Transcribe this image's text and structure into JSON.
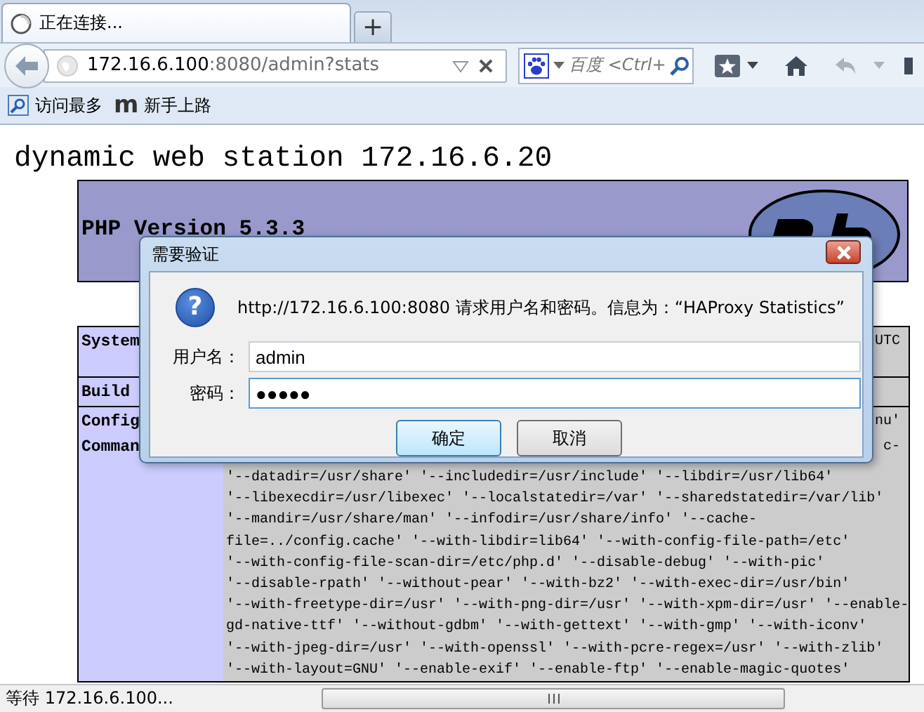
{
  "browser": {
    "tab": {
      "title": "正在连接...",
      "loading": true
    },
    "new_tab": "+",
    "address": {
      "host": "172.16.6.100",
      "rest": ":8080/admin?stats"
    },
    "search": {
      "placeholder": "百度 <Ctrl+"
    },
    "bookmarks": [
      {
        "kind": "page",
        "label": "访问最多"
      },
      {
        "kind": "letter",
        "mark": "m",
        "label": "新手上路"
      }
    ],
    "back_disabled": false,
    "undo_disabled": true
  },
  "page": {
    "heading": "dynamic web station 172.16.6.20",
    "php": {
      "version": "PHP Version 5.3.3"
    },
    "info_rows": [
      {
        "label": "System",
        "value_fragments": [
          "UTC"
        ]
      },
      {
        "label": "Build"
      },
      {
        "label_lines": [
          "Config",
          "Comman"
        ],
        "value_fragments": [
          "nu'",
          "c-"
        ],
        "value_lines": [
          "'--datadir=/usr/share' '--includedir=/usr/include' '--libdir=/usr/lib64'",
          "'--libexecdir=/usr/libexec' '--localstatedir=/var' '--sharedstatedir=/var/lib'",
          "'--mandir=/usr/share/man' '--infodir=/usr/share/info' '--cache-",
          "file=../config.cache' '--with-libdir=lib64' '--with-config-file-path=/etc'",
          "'--with-config-file-scan-dir=/etc/php.d' '--disable-debug' '--with-pic'",
          "'--disable-rpath' '--without-pear' '--with-bz2' '--with-exec-dir=/usr/bin'",
          "'--with-freetype-dir=/usr' '--with-png-dir=/usr' '--with-xpm-dir=/usr' '--enable-",
          "gd-native-ttf' '--without-gdbm' '--with-gettext' '--with-gmp' '--with-iconv'",
          "'--with-jpeg-dir=/usr' '--with-openssl' '--with-pcre-regex=/usr' '--with-zlib'",
          "'--with-layout=GNU' '--enable-exif' '--enable-ftp' '--enable-magic-quotes'"
        ]
      }
    ]
  },
  "dialog": {
    "title": "需要验证",
    "icon_glyph": "?",
    "message": "http://172.16.6.100:8080 请求用户名和密码。信息为：“HAProxy Statistics”",
    "fields": [
      {
        "label": "用户名：",
        "value": "admin",
        "focused": false
      },
      {
        "label": "密码：",
        "value": "●●●●●",
        "focused": true
      }
    ],
    "buttons": [
      {
        "label": "确定",
        "default": true
      },
      {
        "label": "取消",
        "default": false
      }
    ]
  },
  "status_bar": {
    "text": "等待 172.16.6.100..."
  }
}
